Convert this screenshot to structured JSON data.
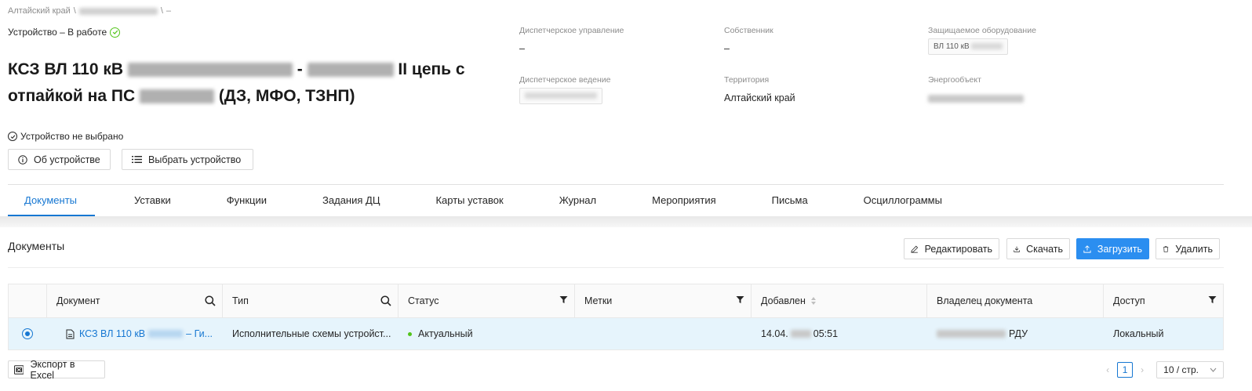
{
  "breadcrumb": {
    "region": "Алтайский край",
    "sep": "\\",
    "last": "–"
  },
  "status": {
    "text": "Устройство – В работе"
  },
  "title": {
    "p1": "КСЗ ВЛ 110 кВ",
    "p2": "-",
    "p3": "II цепь с",
    "p4": "отпайкой на ПС",
    "p5": "(ДЗ, МФО, ТЗНП)"
  },
  "device_note": "Устройство не выбрано",
  "buttons": {
    "about": "Об устройстве",
    "select": "Выбрать устройство",
    "edit": "Редактировать",
    "download": "Скачать",
    "upload": "Загрузить",
    "delete": "Удалить",
    "export": "Экспорт в Excel"
  },
  "meta": {
    "dispatch_mgmt_label": "Диспетчерское управление",
    "dispatch_mgmt_value": "–",
    "owner_label": "Собственник",
    "owner_value": "–",
    "protected_label": "Защищаемое оборудование",
    "protected_value": "ВЛ 110 кВ",
    "dispatch_lead_label": "Диспетчерское ведение",
    "territory_label": "Территория",
    "territory_value": "Алтайский край",
    "energy_label": "Энергообъект"
  },
  "tabs": [
    "Документы",
    "Уставки",
    "Функции",
    "Задания ДЦ",
    "Карты уставок",
    "Журнал",
    "Мероприятия",
    "Письма",
    "Осциллограммы"
  ],
  "section_title": "Документы",
  "table": {
    "headers": [
      "Документ",
      "Тип",
      "Статус",
      "Метки",
      "Добавлен",
      "Владелец документа",
      "Доступ"
    ],
    "row": {
      "doc": "КСЗ ВЛ 110 кВ",
      "doc_tail": "– Ги...",
      "type": "Исполнительные схемы устройст...",
      "status": "Актуальный",
      "tags": "",
      "added_date": "14.04.",
      "added_time": "05:51",
      "owner_suffix": "РДУ",
      "access": "Локальный"
    }
  },
  "pagination": {
    "page": "1",
    "page_size": "10 / стр."
  },
  "colors": {
    "accent": "#1677d2",
    "primary_button": "#2b8ef0",
    "success": "#52c41a",
    "selected_row": "#e6f4fc"
  }
}
